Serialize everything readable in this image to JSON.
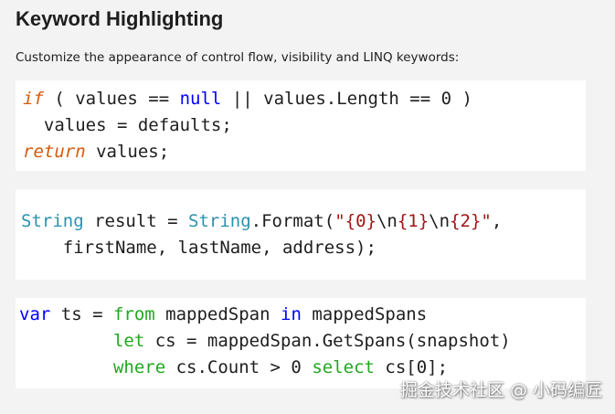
{
  "header": {
    "title": "Keyword Highlighting",
    "subtitle": "Customize the appearance of control flow, visibility and LINQ keywords:"
  },
  "colors": {
    "control_flow": "#d55a0f",
    "keyword": "#0000ff",
    "type": "#2b91af",
    "linq": "#20a820",
    "string": "#a31515",
    "plain": "#1e1e1e"
  },
  "code_blocks": [
    {
      "lines": [
        [
          {
            "text": "if",
            "kind": "control_flow"
          },
          {
            "text": " ( values == ",
            "kind": "plain"
          },
          {
            "text": "null",
            "kind": "keyword"
          },
          {
            "text": " || values.Length == 0 )",
            "kind": "plain"
          }
        ],
        [
          {
            "text": "  values = defaults;",
            "kind": "plain"
          }
        ],
        [
          {
            "text": "return",
            "kind": "control_flow"
          },
          {
            "text": " values;",
            "kind": "plain"
          }
        ]
      ]
    },
    {
      "lines": [
        [
          {
            "text": "String",
            "kind": "type"
          },
          {
            "text": " result = ",
            "kind": "plain"
          },
          {
            "text": "String",
            "kind": "type"
          },
          {
            "text": ".Format(",
            "kind": "plain"
          },
          {
            "text": "\"{0}",
            "kind": "string"
          },
          {
            "text": "\\n",
            "kind": "plain"
          },
          {
            "text": "{1}",
            "kind": "string"
          },
          {
            "text": "\\n",
            "kind": "plain"
          },
          {
            "text": "{2}\"",
            "kind": "string"
          },
          {
            "text": ",",
            "kind": "plain"
          }
        ],
        [
          {
            "text": "    firstName, lastName, address);",
            "kind": "plain"
          }
        ]
      ]
    },
    {
      "lines": [
        [
          {
            "text": "var",
            "kind": "keyword"
          },
          {
            "text": " ts = ",
            "kind": "plain"
          },
          {
            "text": "from",
            "kind": "linq"
          },
          {
            "text": " mappedSpan ",
            "kind": "plain"
          },
          {
            "text": "in",
            "kind": "keyword"
          },
          {
            "text": " mappedSpans",
            "kind": "plain"
          }
        ],
        [
          {
            "text": "         ",
            "kind": "plain"
          },
          {
            "text": "let",
            "kind": "linq"
          },
          {
            "text": " cs = mappedSpan.GetSpans(snapshot)",
            "kind": "plain"
          }
        ],
        [
          {
            "text": "         ",
            "kind": "plain"
          },
          {
            "text": "where",
            "kind": "linq"
          },
          {
            "text": " cs.Count > 0 ",
            "kind": "plain"
          },
          {
            "text": "select",
            "kind": "linq"
          },
          {
            "text": " cs[0];",
            "kind": "plain"
          }
        ]
      ]
    }
  ],
  "watermark": "掘金技术社区 @ 小码编匠"
}
